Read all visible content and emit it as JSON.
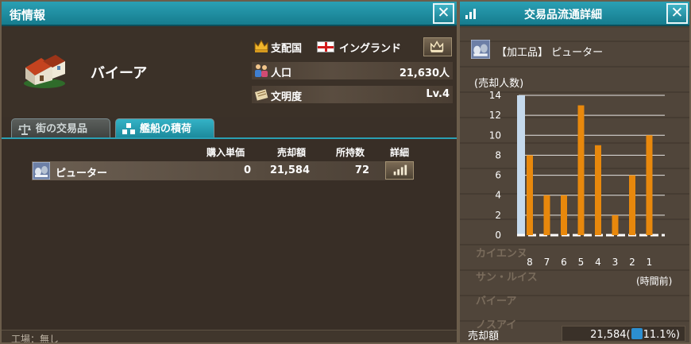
{
  "city_window": {
    "title": "街情報",
    "city_name": "バイーア",
    "ruler": {
      "label": "支配国",
      "country": "イングランド"
    },
    "population": {
      "label": "人口",
      "value": "21,630人"
    },
    "civilization": {
      "label": "文明度",
      "value": "Lv.4"
    },
    "tabs": [
      {
        "label": "街の交易品",
        "active": false
      },
      {
        "label": "艦船の積荷",
        "active": true
      }
    ],
    "table": {
      "headers": [
        "購入単価",
        "売却額",
        "所持数",
        "詳細"
      ],
      "rows": [
        {
          "name": "ピューター",
          "buy": "0",
          "sell": "21,584",
          "hold": "72"
        }
      ]
    },
    "footer": "工場：無し"
  },
  "detail_window": {
    "title": "交易品流通詳細",
    "goods_label": "【加工品】 ピューター",
    "ghost_rows": [
      "カイエンヌ",
      "サン・ルイス",
      "バイーア",
      "ノスアイ"
    ],
    "sale": {
      "label": "売却額",
      "value": "21,584(",
      "trend": "up",
      "percent": "11.1%)"
    }
  },
  "chart_data": {
    "type": "bar",
    "ylabel": "(売却人数)",
    "xlabel": "(時間前)",
    "categories": [
      "8",
      "7",
      "6",
      "5",
      "4",
      "3",
      "2",
      "1"
    ],
    "series": [
      {
        "values": [
          8,
          4,
          4,
          13,
          9,
          2,
          6,
          10
        ]
      }
    ],
    "highlight_value": 14,
    "ylim": [
      0,
      14
    ],
    "yticks": [
      0,
      2,
      4,
      6,
      8,
      10,
      12,
      14
    ],
    "colors": {
      "bar": "#e8880c",
      "highlight": "#c5d9ec",
      "axis": "#ffffff"
    },
    "grid": true
  }
}
